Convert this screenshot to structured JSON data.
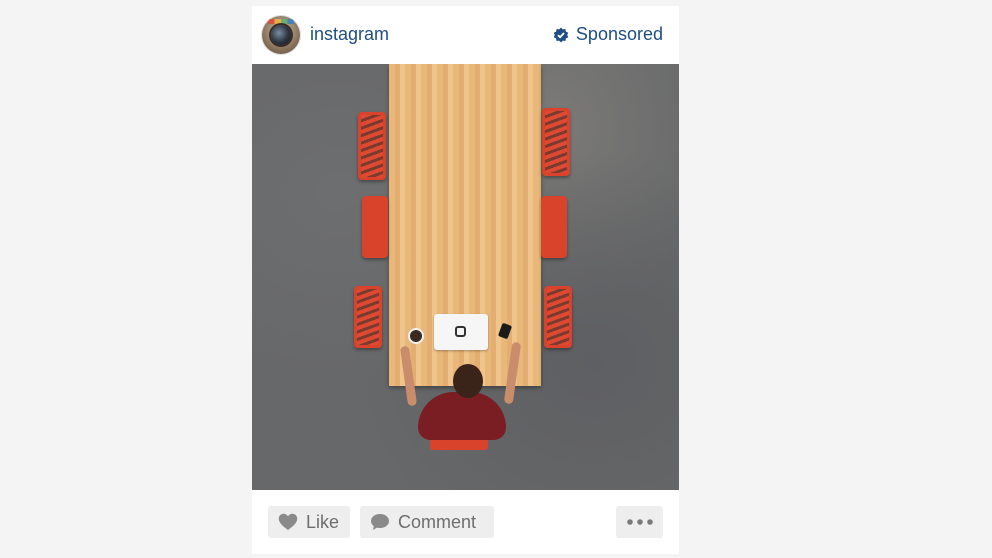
{
  "post": {
    "username": "instagram",
    "sponsored_label": "Sponsored"
  },
  "actions": {
    "like_label": "Like",
    "comment_label": "Comment"
  },
  "icons": {
    "avatar": "camera-avatar-icon",
    "sponsored": "sponsored-badge-icon",
    "like": "heart-icon",
    "comment": "speech-bubble-icon",
    "more": "more-dots-icon"
  },
  "colors": {
    "link": "#1f4e82",
    "button_bg": "#eeeeee",
    "button_text": "#6e6e6e"
  }
}
